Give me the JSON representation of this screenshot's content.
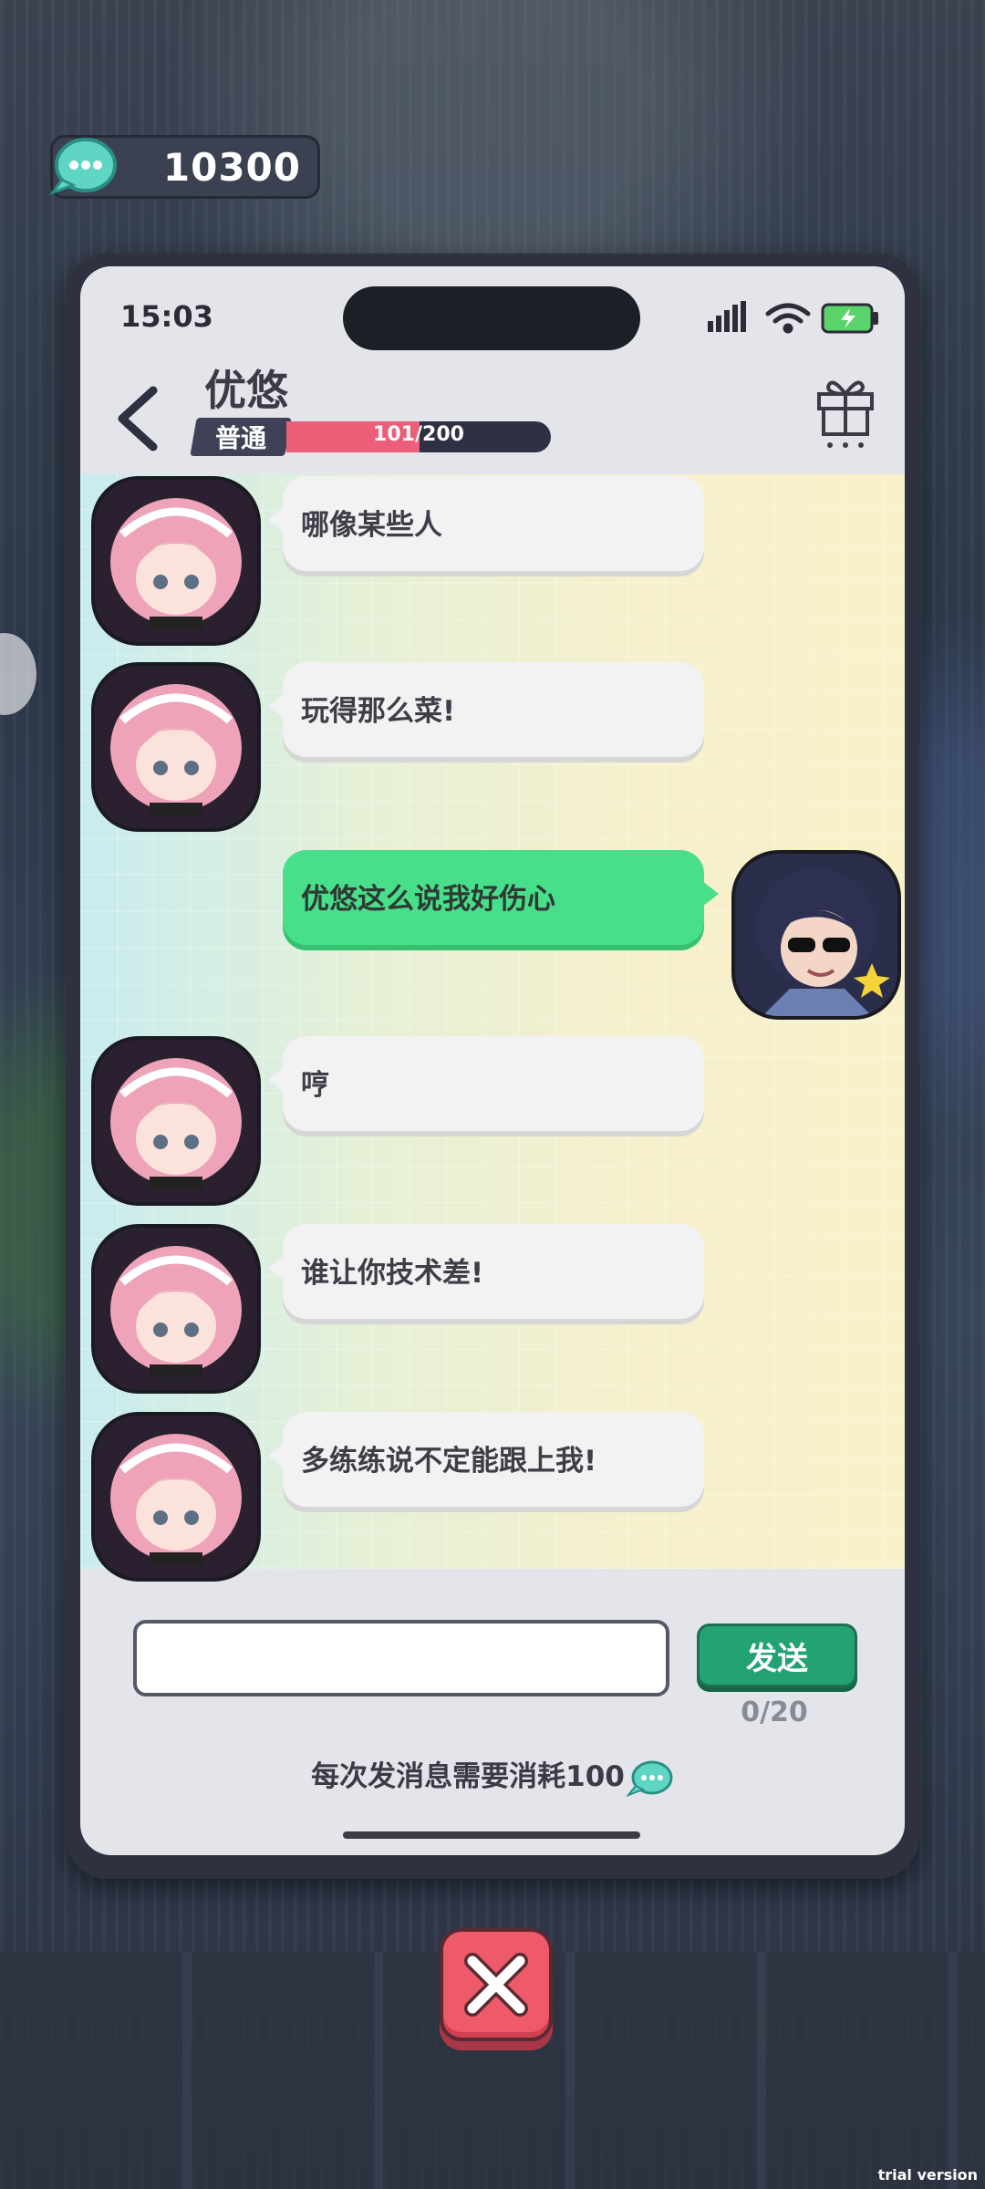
{
  "currency": {
    "amount": "10300",
    "icon": "chat-bubble-coin-icon"
  },
  "status_bar": {
    "time": "15:03"
  },
  "header": {
    "contact_name": "优悠",
    "rank": "普通",
    "affinity_text": "101/200",
    "affinity_value": 101,
    "affinity_max": 200
  },
  "messages": [
    {
      "sender": "her",
      "text": "哪像某些人"
    },
    {
      "sender": "her",
      "text": "玩得那么菜!"
    },
    {
      "sender": "me",
      "text": "优悠这么说我好伤心"
    },
    {
      "sender": "her",
      "text": "哼"
    },
    {
      "sender": "her",
      "text": "谁让你技术差!"
    },
    {
      "sender": "her",
      "text": "多练练说不定能跟上我!"
    }
  ],
  "composer": {
    "input_value": "",
    "send_label": "发送",
    "char_count": "0/20",
    "cost_note": "每次发消息需要消耗100"
  },
  "watermark": "trial version",
  "colors": {
    "my_bubble": "#47df8a",
    "her_bubble": "#f2f2f2",
    "send_button": "#23a274",
    "affinity_fill": "#ec5f78",
    "close_button": "#ef5a6a"
  }
}
